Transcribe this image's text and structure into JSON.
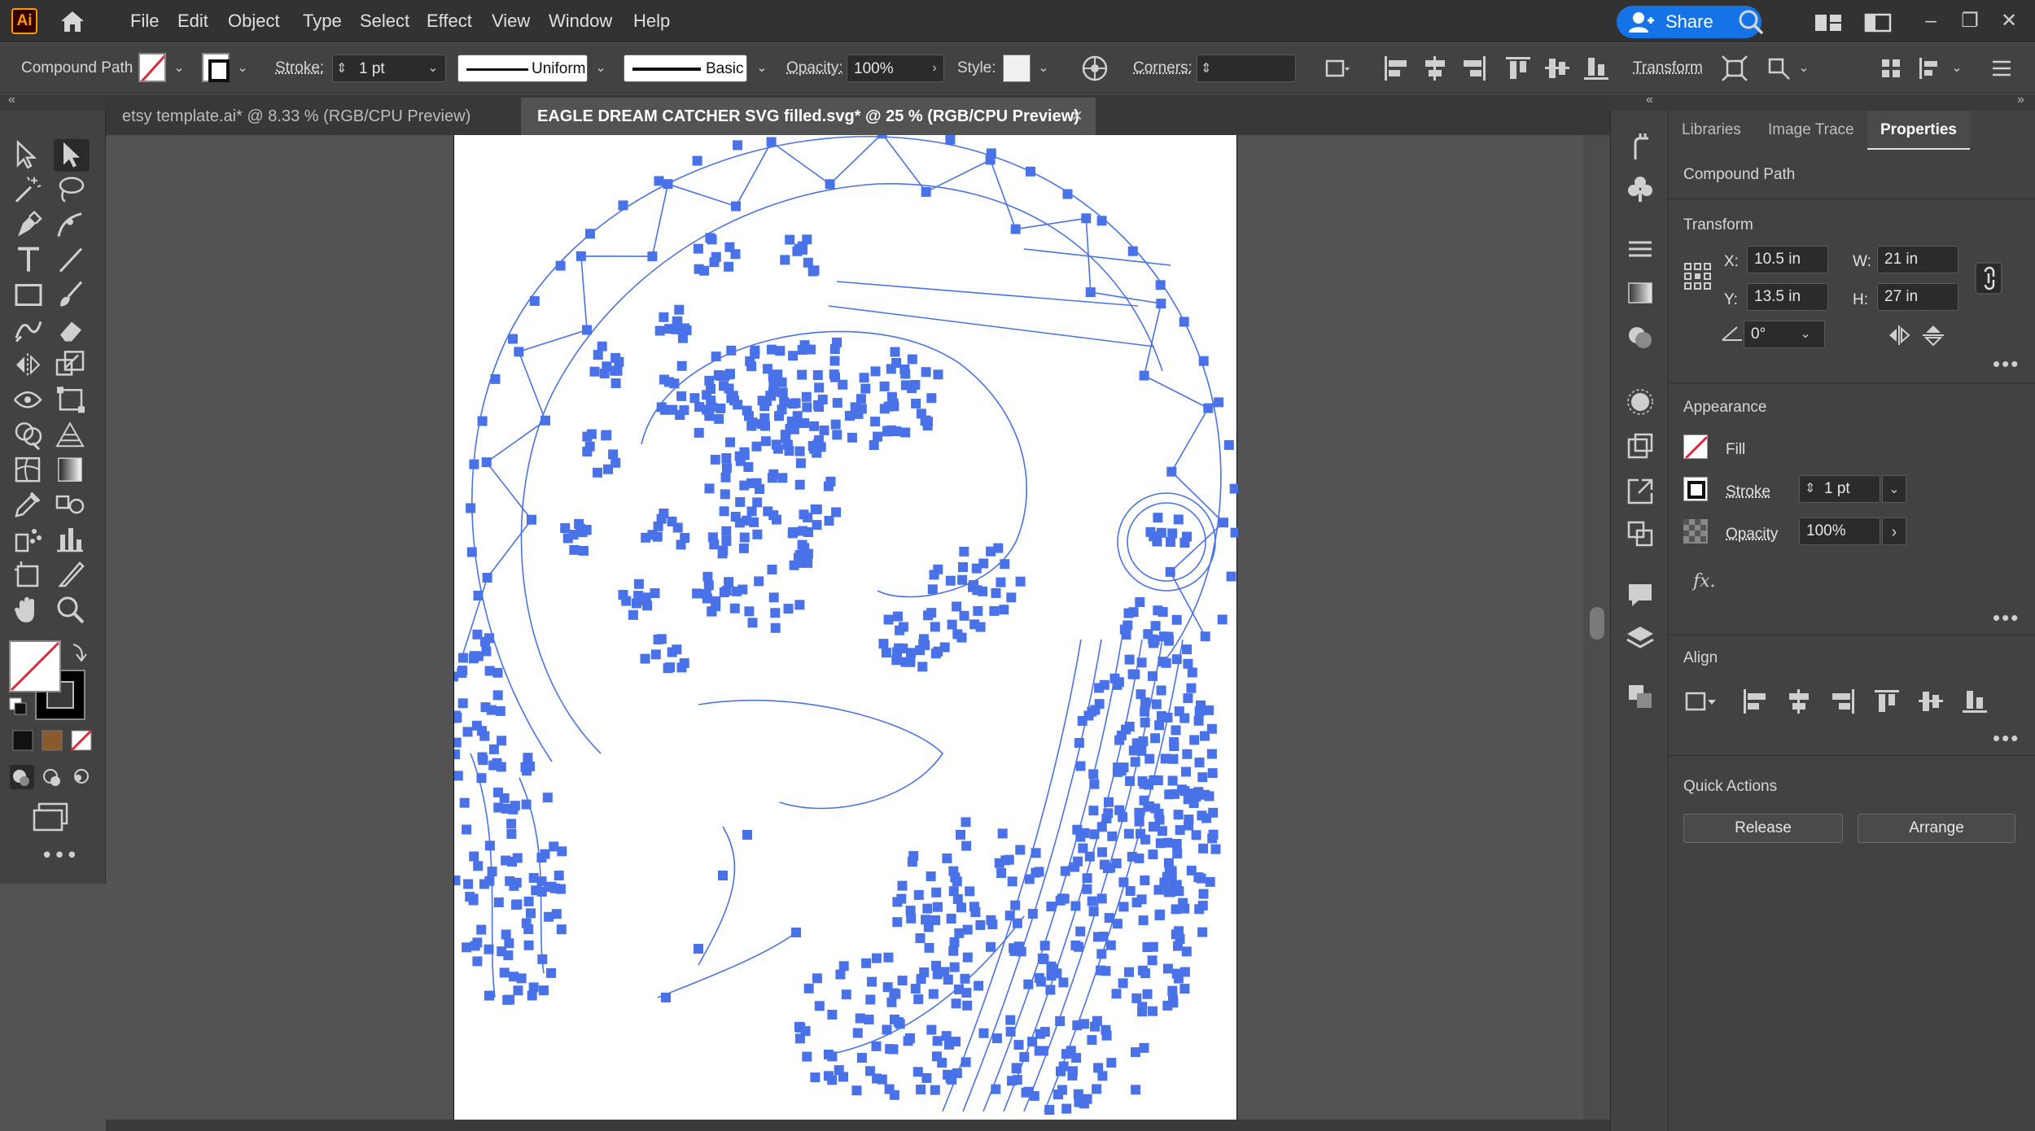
{
  "app": {
    "logo_text": "Ai",
    "menu": [
      "File",
      "Edit",
      "Object",
      "Type",
      "Select",
      "Effect",
      "View",
      "Window",
      "Help"
    ],
    "share_label": "Share"
  },
  "control_bar": {
    "object_type": "Compound Path",
    "stroke_label": "Stroke:",
    "stroke_weight": "1 pt",
    "profile_label": "Uniform",
    "brush_label": "Basic",
    "opacity_label": "Opacity:",
    "opacity_value": "100%",
    "style_label": "Style:",
    "corners_label": "Corners:",
    "transform_label": "Transform"
  },
  "tabs": [
    {
      "label": "etsy template.ai* @ 8.33 % (RGB/CPU Preview)",
      "active": false
    },
    {
      "label": "EAGLE DREAM CATCHER SVG filled.svg* @ 25 % (RGB/CPU Preview)",
      "active": true
    }
  ],
  "panel": {
    "tabs": [
      "Libraries",
      "Image Trace",
      "Properties"
    ],
    "object_type": "Compound Path",
    "transform": {
      "title": "Transform",
      "x_label": "X:",
      "x": "10.5 in",
      "y_label": "Y:",
      "y": "13.5 in",
      "w_label": "W:",
      "w": "21 in",
      "h_label": "H:",
      "h": "27 in",
      "angle": "0°"
    },
    "appearance": {
      "title": "Appearance",
      "fill_label": "Fill",
      "stroke_label": "Stroke",
      "stroke_value": "1 pt",
      "opacity_label": "Opacity",
      "opacity_value": "100%",
      "fx_label": "fx."
    },
    "align": {
      "title": "Align"
    },
    "quick_actions": {
      "title": "Quick Actions",
      "release": "Release",
      "arrange": "Arrange"
    }
  },
  "colors": {
    "anchor": "#4a72e8",
    "path": "#4a72e8",
    "accent": "#1473e6",
    "none_slash": "#e3263a"
  }
}
